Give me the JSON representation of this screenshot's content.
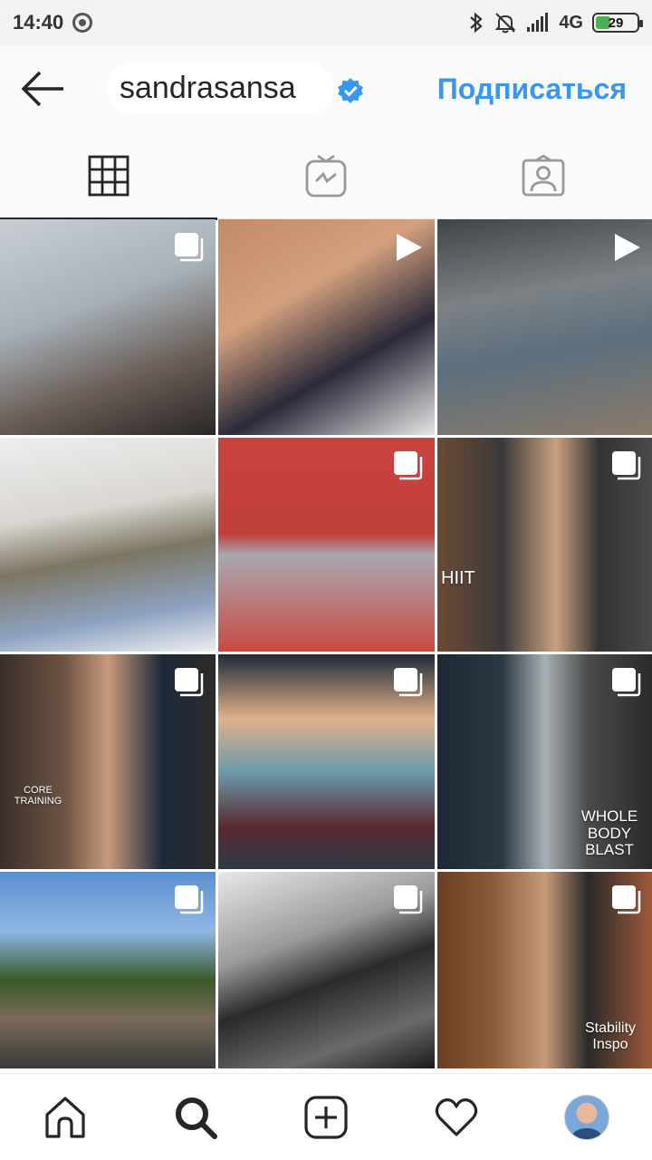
{
  "status_bar": {
    "time": "14:40",
    "network": "4G",
    "battery_level": "29"
  },
  "header": {
    "username": "sandrasansa",
    "follow_label": "Подписаться",
    "accent_color": "#3897f0"
  },
  "tabs": [
    {
      "icon": "grid-icon",
      "active": true
    },
    {
      "icon": "igtv-icon",
      "active": false
    },
    {
      "icon": "tagged-icon",
      "active": false
    }
  ],
  "posts": [
    {
      "badge": "carousel-icon",
      "caption": ""
    },
    {
      "badge": "video-icon",
      "caption": ""
    },
    {
      "badge": "video-icon",
      "caption": ""
    },
    {
      "badge": "",
      "caption": ""
    },
    {
      "badge": "carousel-icon",
      "caption": ""
    },
    {
      "badge": "carousel-icon",
      "caption": "HIIT"
    },
    {
      "badge": "carousel-icon",
      "caption": "CORE TRAINING"
    },
    {
      "badge": "carousel-icon",
      "caption": ""
    },
    {
      "badge": "carousel-icon",
      "caption": "WHOLE BODY BLAST"
    },
    {
      "badge": "carousel-icon",
      "caption": ""
    },
    {
      "badge": "carousel-icon",
      "caption": ""
    },
    {
      "badge": "carousel-icon",
      "caption": "Stability Inspo"
    }
  ],
  "bottom_nav": [
    "home-icon",
    "search-icon",
    "new-post-icon",
    "activity-icon",
    "profile-avatar"
  ]
}
